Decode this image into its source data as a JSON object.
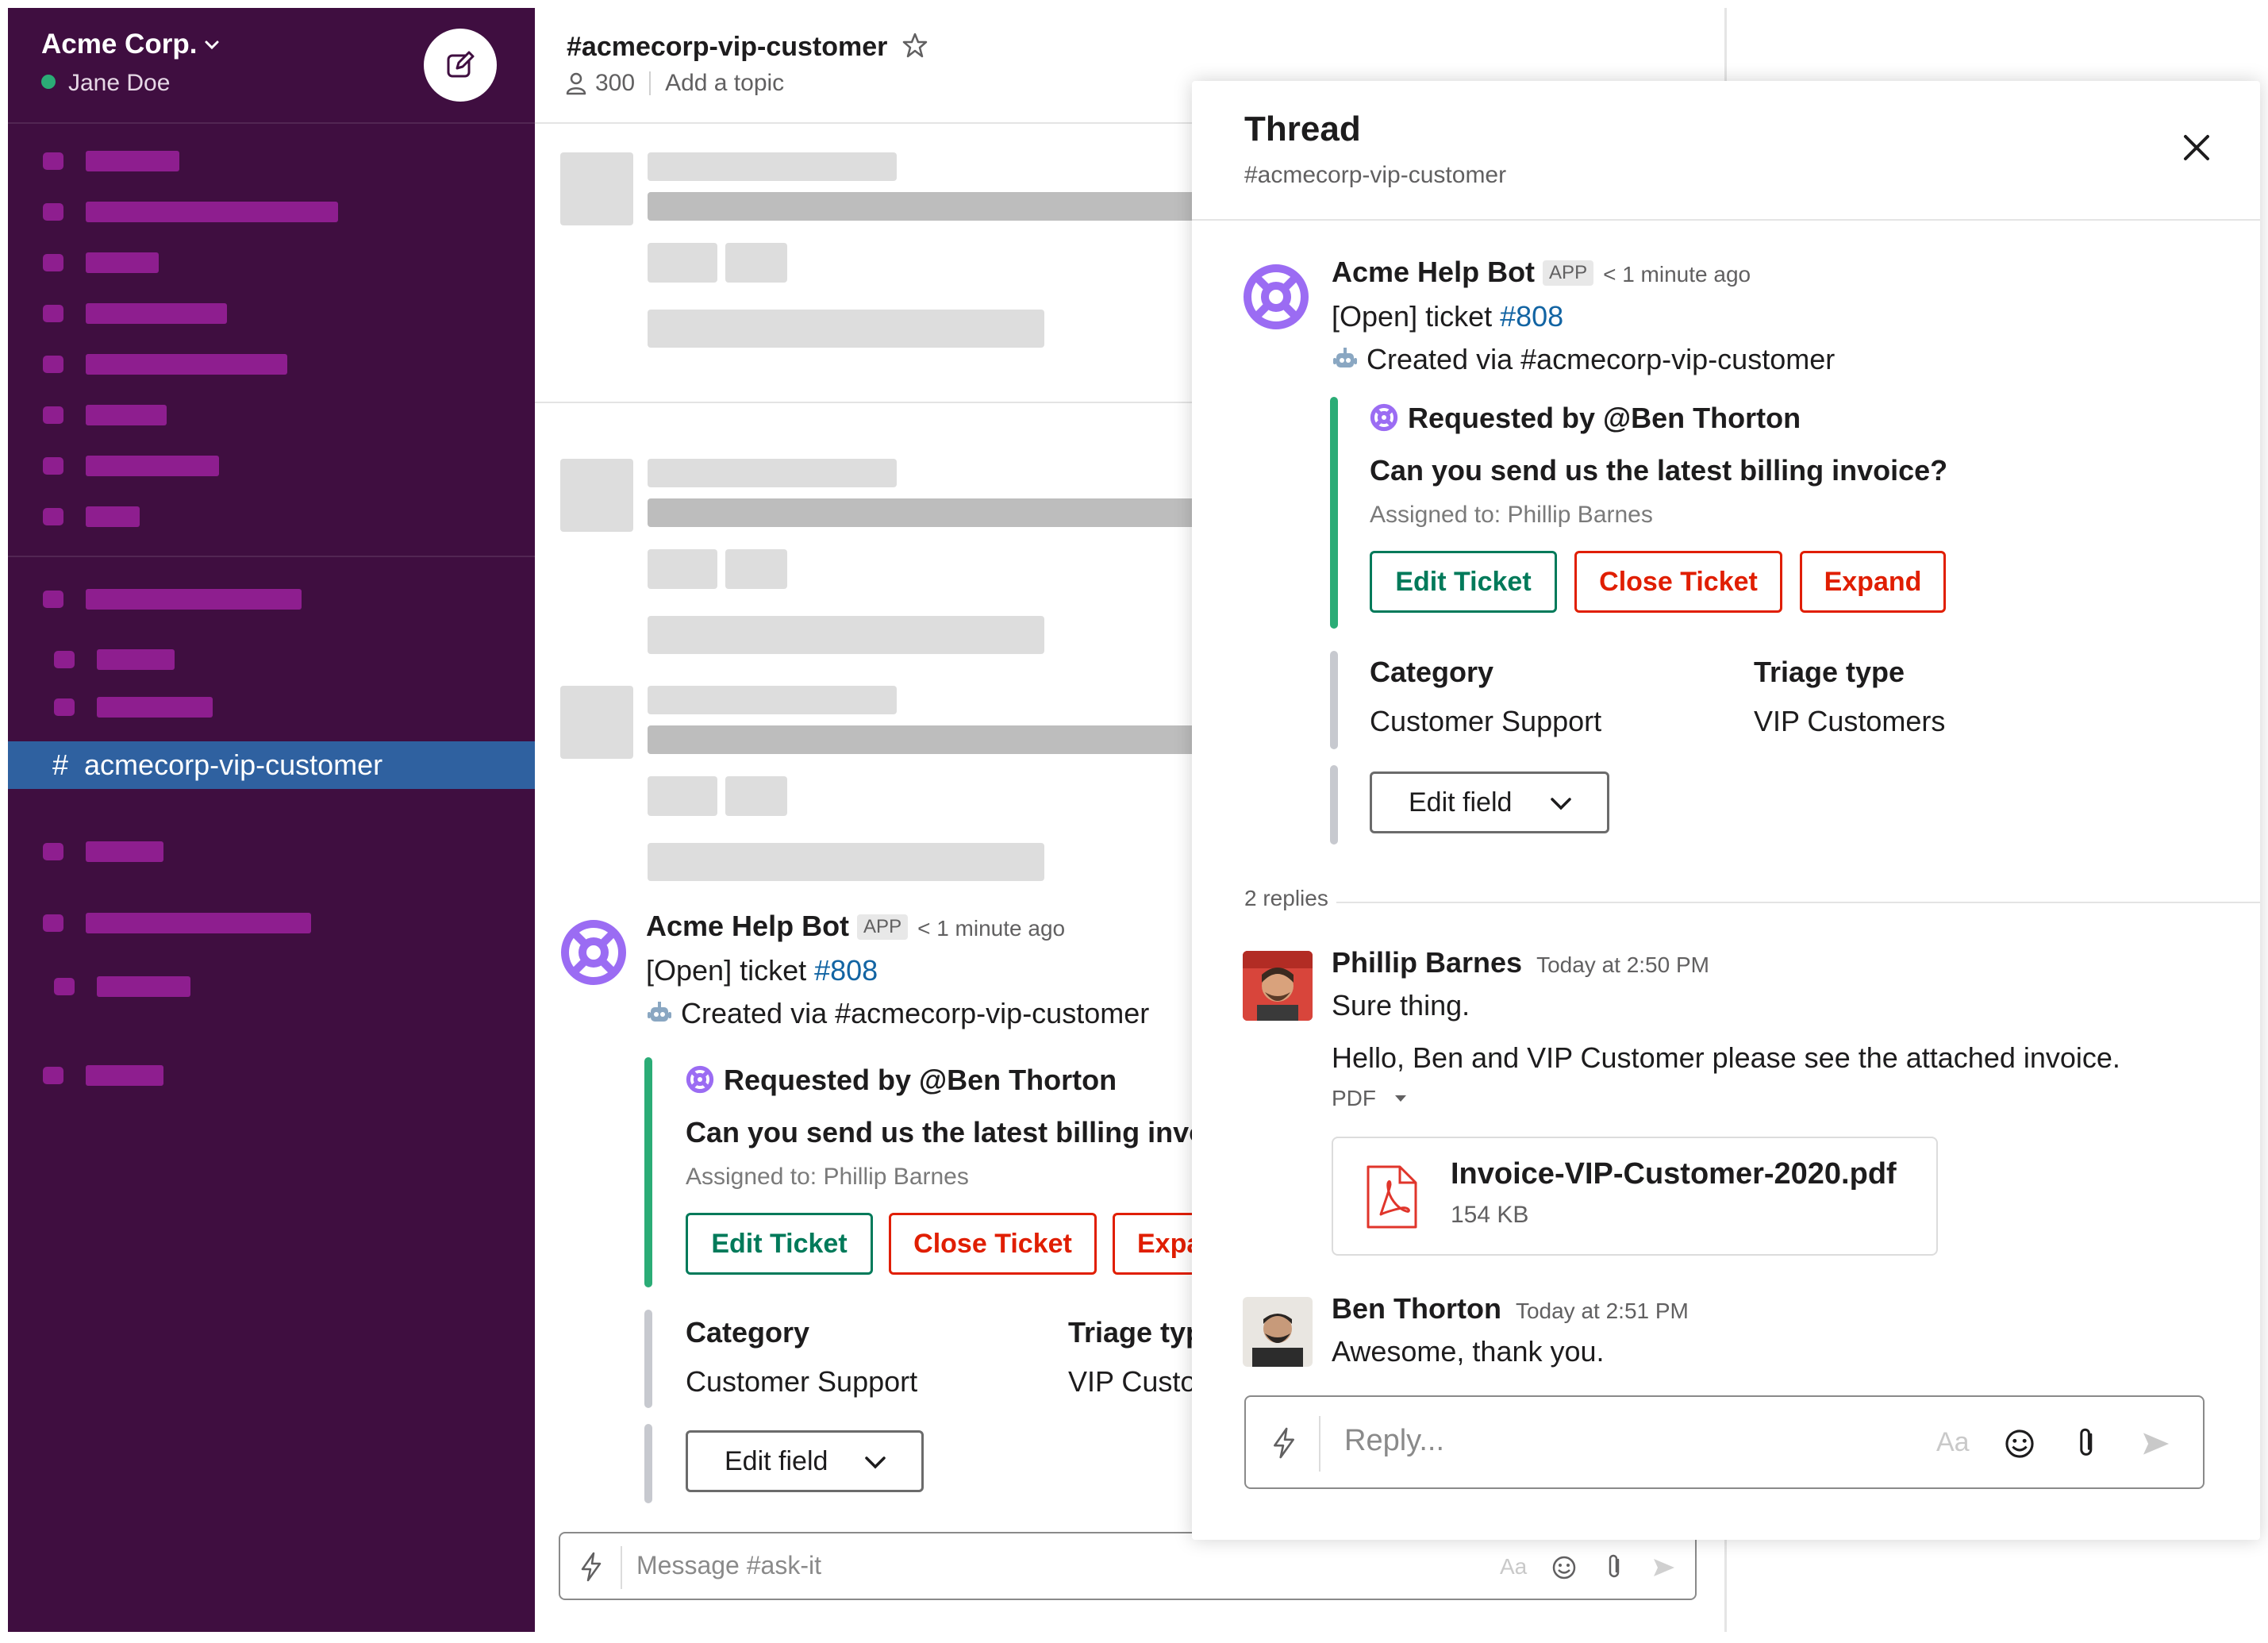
{
  "workspace": {
    "name": "Acme Corp.",
    "user": "Jane Doe",
    "status_color": "#2bac76"
  },
  "sidebar": {
    "active_channel_hash": "#",
    "active_channel": "acmecorp-vip-customer"
  },
  "channel": {
    "title": "#acmecorp-vip-customer",
    "member_count": "300",
    "topic_placeholder": "Add a topic",
    "composer_placeholder": "Message #ask-it"
  },
  "bot_message": {
    "sender": "Acme Help Bot",
    "badge": "APP",
    "time": "< 1 minute ago",
    "status_prefix": "[Open] ticket ",
    "ticket_link": "#808",
    "created_via": "Created via #acmecorp-vip-customer",
    "requested_by": "Requested by @Ben Thorton",
    "question": "Can you send us the latest billing invoice?",
    "assigned_to": "Assigned to: Phillip Barnes",
    "buttons": {
      "edit": "Edit Ticket",
      "close": "Close Ticket",
      "expand": "Expand"
    },
    "fields": [
      {
        "label": "Category",
        "value": "Customer Support"
      },
      {
        "label": "Triage type",
        "value": "VIP Customers"
      }
    ],
    "edit_field": "Edit field",
    "channel_truncated": {
      "question": "Can you send us the latest billing invoi",
      "expand": "Expa",
      "triage_label": "Triage typ",
      "triage_value": "VIP Custo"
    }
  },
  "thread": {
    "title": "Thread",
    "subtitle": "#acmecorp-vip-customer",
    "replies_label": "2 replies",
    "replies": [
      {
        "sender": "Phillip Barnes",
        "time": "Today at 2:50 PM",
        "lines": [
          "Sure thing.",
          "Hello, Ben and VIP Customer please see the attached invoice."
        ],
        "file_type": "PDF",
        "file": {
          "name": "Invoice-VIP-Customer-2020.pdf",
          "size": "154 KB"
        }
      },
      {
        "sender": "Ben Thorton",
        "time": "Today at 2:51 PM",
        "lines": [
          "Awesome, thank you."
        ]
      }
    ],
    "reply_placeholder": "Reply..."
  },
  "composer_text_icon": "Aa",
  "colors": {
    "sidebar": "#3f0e40",
    "active": "#2f61a0",
    "accent_green": "#007a5a",
    "danger": "#e01e00",
    "link": "#1264a3",
    "bot_purple": "#9b6cf3"
  },
  "icons": [
    "chevron-down-icon",
    "compose-icon",
    "star-icon",
    "member-icon",
    "close-icon",
    "bolt-icon",
    "emoji-icon",
    "paperclip-icon",
    "send-icon",
    "pdf-icon",
    "robot-icon",
    "lifebuoy-icon"
  ]
}
